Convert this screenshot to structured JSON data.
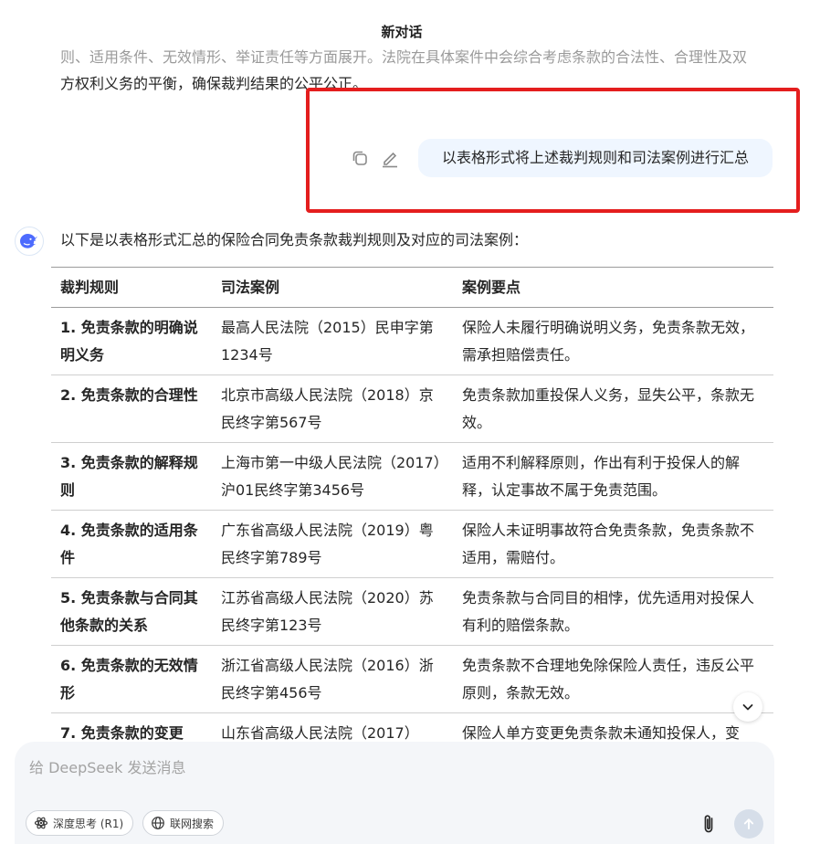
{
  "header": {
    "title": "新对话"
  },
  "previous_answer": {
    "line1": "则、适用条件、无效情形、举证责任等方面展开。法院在具体案件中会综合考虑条款的合法性、合理性及双",
    "line2": "方权利义务的平衡，确保裁判结果的公平公正。"
  },
  "user_message": {
    "text": "以表格形式将上述裁判规则和司法案例进行汇总",
    "copy_icon": "copy-icon",
    "edit_icon": "edit-icon"
  },
  "assistant": {
    "avatar_icon": "deepseek-whale-icon",
    "intro": "以下是以表格形式汇总的保险合同免责条款裁判规则及对应的司法案例：",
    "table": {
      "headers": [
        "裁判规则",
        "司法案例",
        "案例要点"
      ],
      "rows": [
        [
          "1. 免责条款的明确说明义务",
          "最高人民法院（2015）民申字第1234号",
          "保险人未履行明确说明义务，免责条款无效，需承担赔偿责任。"
        ],
        [
          "2. 免责条款的合理性",
          "北京市高级人民法院（2018）京民终字第567号",
          "免责条款加重投保人义务，显失公平，条款无效。"
        ],
        [
          "3. 免责条款的解释规则",
          "上海市第一中级人民法院（2017）沪01民终字第3456号",
          "适用不利解释原则，作出有利于投保人的解释，认定事故不属于免责范围。"
        ],
        [
          "4. 免责条款的适用条件",
          "广东省高级人民法院（2019）粤民终字第789号",
          "保险人未证明事故符合免责条款，免责条款不适用，需赔付。"
        ],
        [
          "5. 免责条款与合同其他条款的关系",
          "江苏省高级人民法院（2020）苏民终字第123号",
          "免责条款与合同目的相悖，优先适用对投保人有利的赔偿条款。"
        ],
        [
          "6. 免责条款的无效情形",
          "浙江省高级人民法院（2016）浙民终字第456号",
          "免责条款不合理地免除保险人责任，违反公平原则，条款无效。"
        ],
        [
          "7. 免责条款的变更",
          "山东省高级人民法院（2017）",
          "保险人单方变更免责条款未通知投保人，变"
        ]
      ]
    }
  },
  "scroll_down_icon": "chevron-down-icon",
  "composer": {
    "placeholder": "给 DeepSeek 发送消息",
    "deep_think_label": "深度思考 (R1)",
    "deep_think_icon": "atom-icon",
    "web_search_label": "联网搜索",
    "web_search_icon": "globe-icon",
    "attach_icon": "paperclip-icon",
    "send_icon": "arrow-up-icon"
  },
  "colors": {
    "highlight_border": "#e41e1e",
    "user_bubble": "#eff6ff",
    "brand_blue": "#4d6bfe",
    "composer_bg": "#f4f6f9"
  }
}
